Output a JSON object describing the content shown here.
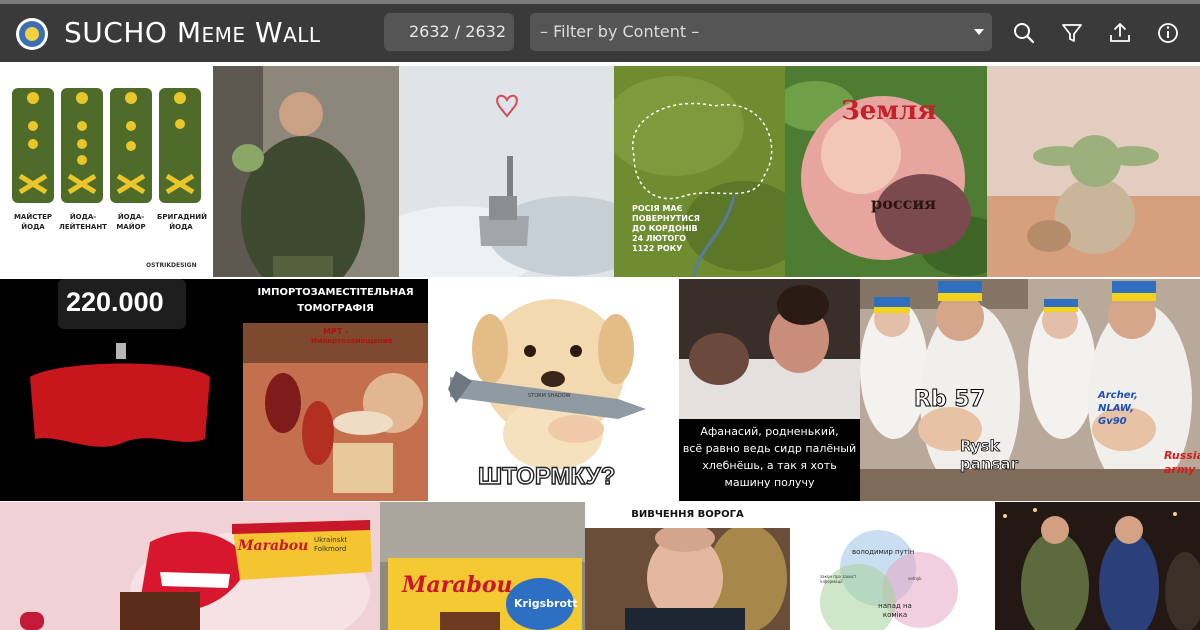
{
  "app": {
    "title_first": "SUCHO",
    "title_rest": "Meme Wall",
    "counter": "2632 / 2632",
    "filter_placeholder": "– Filter by Content –"
  },
  "header_icons": [
    "search-icon",
    "filter-icon",
    "upload-icon",
    "info-icon"
  ],
  "colors": {
    "header": "#3a3a3a",
    "input": "#555555",
    "stripe": "#7a7a7a"
  },
  "memes": {
    "insignia": {
      "labels": [
        "МАЙСТЕР ЙОДА",
        "ЙОДА-ЛЕЙТЕНАНТ",
        "ЙОДА-МАЙОР",
        "БРИГАДНИЙ ЙОДА"
      ],
      "credit": "OSTRIKDESIGN"
    },
    "green_map": {
      "caption": [
        "РОСІЯ МАЄ",
        "ПОВЕРНУТИСЯ",
        "ДО КОРДОНІВ",
        "24 ЛЮТОГО",
        "1122 РОКУ"
      ]
    },
    "apple": {
      "top": "Земля",
      "bottom": "россия"
    },
    "count_220": {
      "number": "220.000"
    },
    "tomography": {
      "title": [
        "ІМПОРТОЗАМЕСТІТЕЛЬНАЯ",
        "ТОМОГРАФІЯ"
      ],
      "scroll": "МРТ -",
      "scroll2": "Импортозамещение"
    },
    "puppy": {
      "caption": "ШТОРМКУ?",
      "missile": "STORM SHADOW"
    },
    "film": {
      "caption": [
        "Афанасий, родненький,",
        "всё равно ведь сидр палёный",
        "хлебнёшь, а так я хоть",
        "машину получу"
      ]
    },
    "chefs1": {
      "big": "Rb 57",
      "small": [
        "Rysk",
        "pansar"
      ]
    },
    "chefs2": {
      "blue": [
        "Archer,",
        "NLAW,",
        "Gv90"
      ],
      "red": [
        "Russian",
        "army"
      ]
    },
    "marabou1": {
      "brand": "Marabou",
      "flavor": [
        "Ukrainskt",
        "Folkmord"
      ]
    },
    "marabou2": {
      "brand": "Marabou",
      "flavor": "Krigsbrott"
    },
    "putin": {
      "caption": "ВИВЧЕННЯ ВОРОГА"
    },
    "venn": {
      "labels": [
        "володимир путін",
        "закон про захист інформації",
        "напад на коміка",
        "vetnyk"
      ]
    }
  }
}
